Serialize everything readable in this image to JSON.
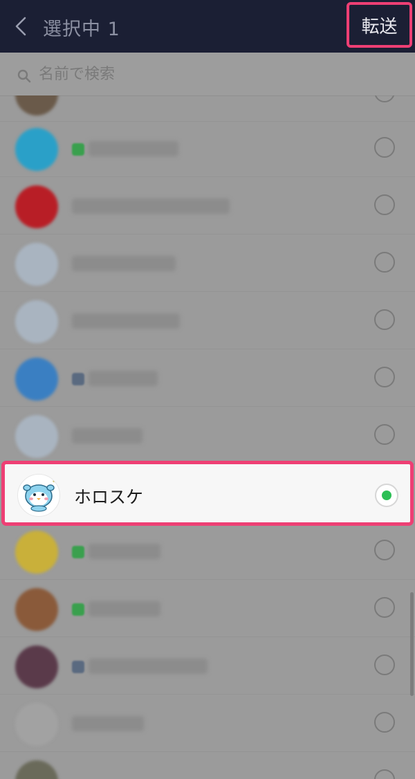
{
  "header": {
    "title": "選択中 1",
    "send_label": "転送"
  },
  "search": {
    "placeholder": "名前で検索"
  },
  "selected_contact": {
    "name": "ホロスケ",
    "selected": true
  },
  "colors": {
    "header_bg": "#1b1f34",
    "highlight": "#ee3f74",
    "selected_radio": "#2cbf55"
  }
}
